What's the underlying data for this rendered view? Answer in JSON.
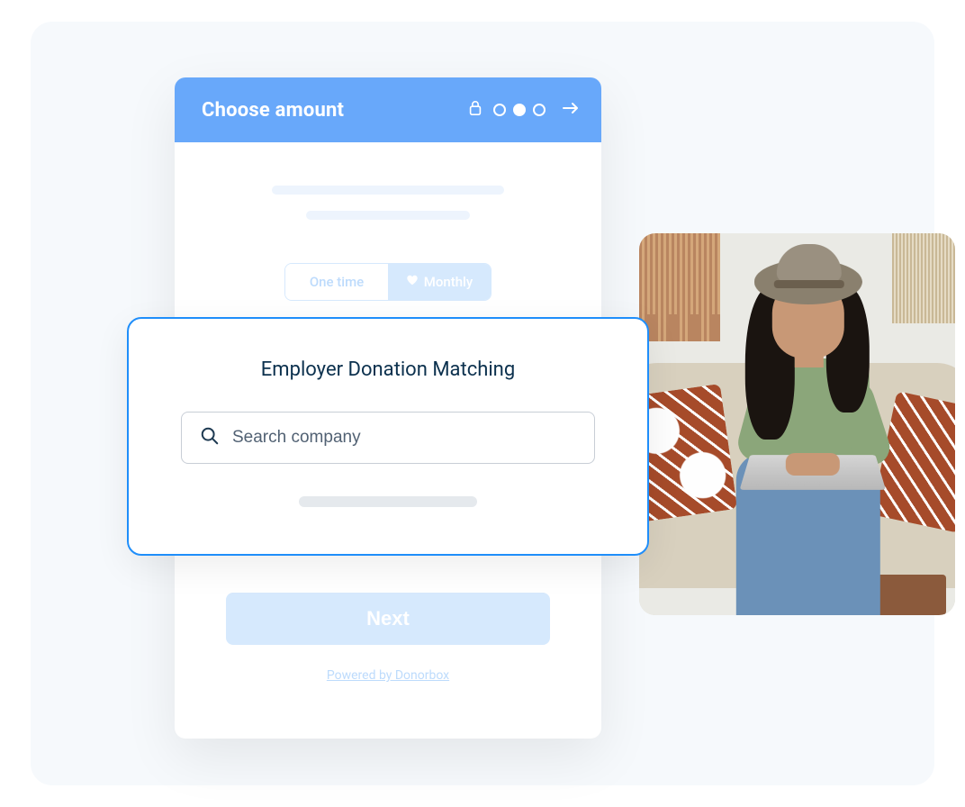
{
  "header": {
    "title": "Choose amount"
  },
  "frequency": {
    "onetime": "One time",
    "monthly": "Monthly"
  },
  "matching": {
    "title": "Employer Donation Matching",
    "searchPlaceholder": "Search company"
  },
  "nextButton": "Next",
  "poweredBy": "Powered by Donorbox"
}
